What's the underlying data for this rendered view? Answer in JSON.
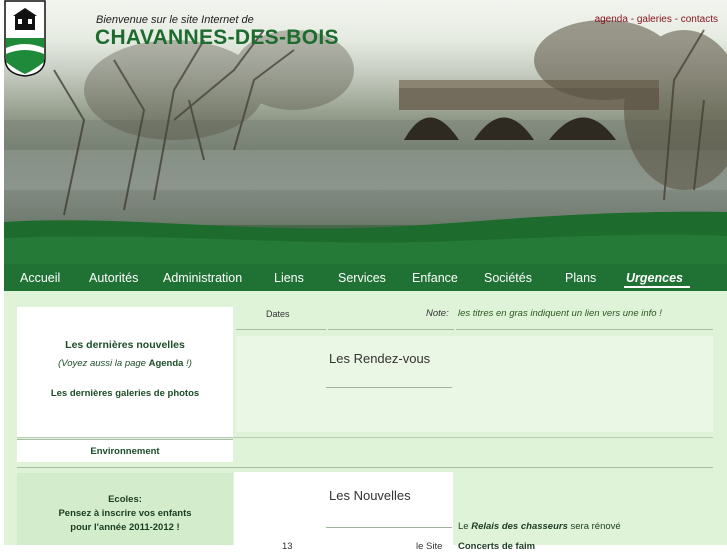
{
  "header": {
    "welcome": "Bienvenue sur le site Internet de",
    "site_name": "CHAVANNES-DES-BOIS",
    "links": [
      {
        "label": "agenda"
      },
      {
        "label": "galeries"
      },
      {
        "label": "contacts"
      }
    ],
    "separator": " - "
  },
  "nav": {
    "items": [
      {
        "label": "Accueil"
      },
      {
        "label": "Autorités"
      },
      {
        "label": "Administration"
      },
      {
        "label": "Liens"
      },
      {
        "label": "Services"
      },
      {
        "label": "Enfance"
      },
      {
        "label": "Sociétés"
      },
      {
        "label": "Plans"
      },
      {
        "label": "Urgences"
      }
    ]
  },
  "left": {
    "news_title": "Les dernières nouvelles",
    "see_also_prefix": "(Voyez aussi la page ",
    "see_also_link": "Agenda",
    "see_also_suffix": " !)",
    "galleries": "Les dernières galeries de photos",
    "environment": "Environnement",
    "ecoles_title": "Ecoles:",
    "ecoles_line1": "Pensez à inscrire vos enfants",
    "ecoles_line2": "pour l'année 2011-2012 !"
  },
  "main": {
    "dates_header": "Dates",
    "note_label": "Note:",
    "note_text": "les titres en gras indiquent un lien vers une info !",
    "rdv_title": "Les Rendez-vous",
    "news_title": "Les Nouvelles",
    "news_item_prefix": "Le ",
    "news_item_name": "Relais des chasseurs",
    "news_item_suffix": " sera rénové",
    "cut_left": "13",
    "cut_mid": "le Site",
    "cut_right": "Concerts de faim"
  },
  "colors": {
    "brand_green": "#1d6b2d",
    "nav_bg": "#1f7233",
    "link_red": "#8a1522",
    "content_bg": "#dff3d9"
  }
}
